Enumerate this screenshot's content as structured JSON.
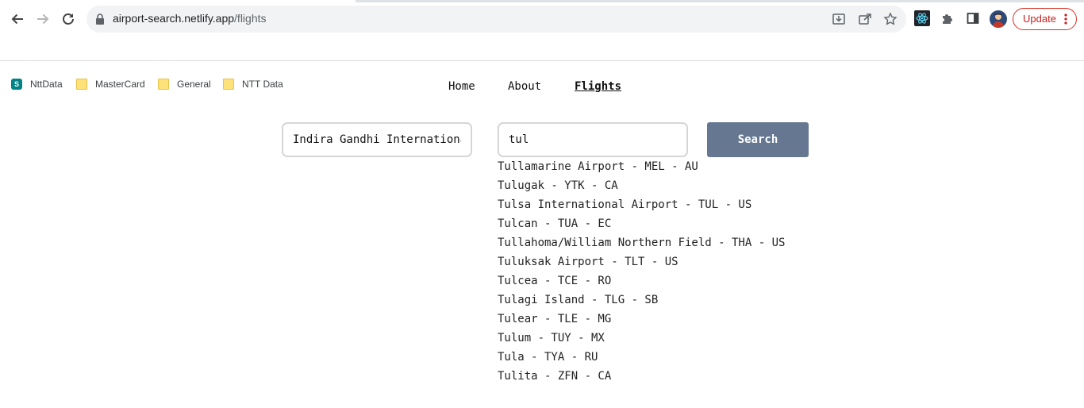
{
  "browser": {
    "url_domain": "airport-search.netlify.app",
    "url_path": "/flights",
    "update_label": "Update",
    "bookmarks": [
      {
        "label": "NttData",
        "icon": "sharepoint-icon"
      },
      {
        "label": "MasterCard",
        "icon": "folder-icon"
      },
      {
        "label": "General",
        "icon": "folder-icon"
      },
      {
        "label": "NTT Data",
        "icon": "folder-icon"
      }
    ]
  },
  "nav": {
    "home": "Home",
    "about": "About",
    "flights": "Flights"
  },
  "search": {
    "from_value": "Indira Gandhi International Airport - DEL - IN",
    "to_value": "tul",
    "button_label": "Search"
  },
  "suggestions": [
    "Tullamarine Airport - MEL - AU",
    "Tulugak - YTK - CA",
    "Tulsa International Airport - TUL - US",
    "Tulcan - TUA - EC",
    "Tullahoma/William Northern Field - THA - US",
    "Tuluksak Airport - TLT - US",
    "Tulcea - TCE - RO",
    "Tulagi Island - TLG - SB",
    "Tulear - TLE - MG",
    "Tulum - TUY - MX",
    "Tula - TYA - RU",
    "Tulita - ZFN - CA"
  ],
  "colors": {
    "search_button": "#667891",
    "update_accent": "#d93025"
  }
}
